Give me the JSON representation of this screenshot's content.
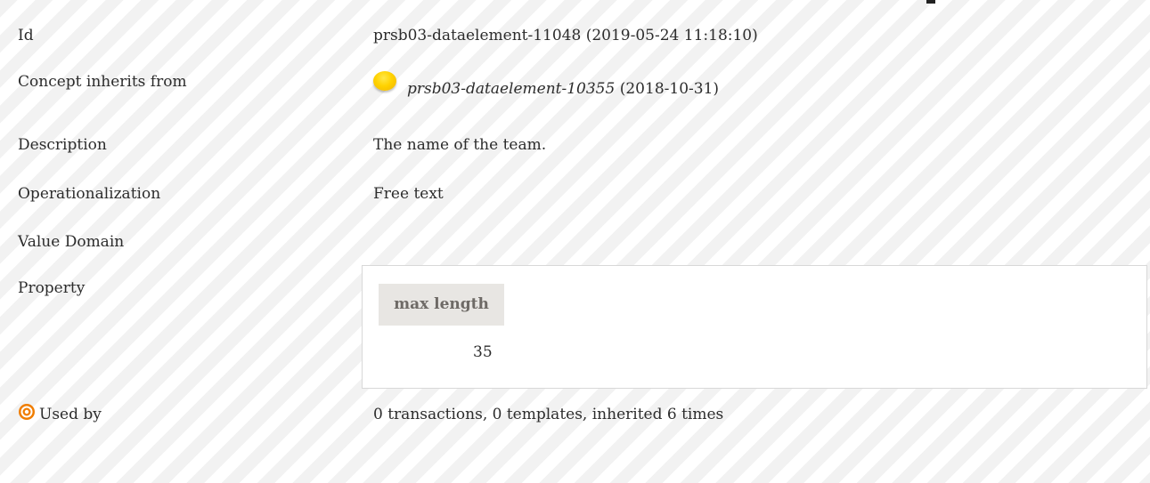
{
  "rows": {
    "id": {
      "label": "Id",
      "value": "prsb03-dataelement-11048 (2019-05-24 11:18:10)"
    },
    "inherits": {
      "label": "Concept inherits from",
      "icon": "yellow-circle-icon",
      "link": "prsb03-dataelement-10355",
      "date": "(2018-10-31)"
    },
    "description": {
      "label": "Description",
      "value": "The name of the team."
    },
    "operationalization": {
      "label": "Operationalization",
      "value": "Free text"
    },
    "value_domain": {
      "label": "Value Domain"
    },
    "property": {
      "label": "Property",
      "header": "max length",
      "value": "35"
    },
    "used_by": {
      "label": "Used by",
      "icon": "target-icon",
      "value": "0 transactions, 0 templates, inherited 6 times"
    }
  },
  "colors": {
    "stripe_light": "#ffffff",
    "stripe_dark": "#f2f2f2",
    "header_bg": "#e8e6e3",
    "header_text": "#6e6a66",
    "icon_yellow": "#ffd200",
    "icon_orange": "#f07d00"
  }
}
